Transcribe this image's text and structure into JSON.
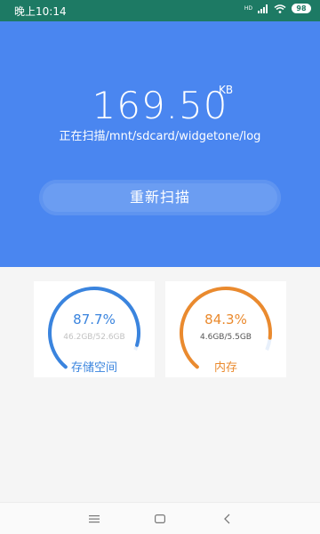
{
  "status_bar": {
    "time": "晚上10:14",
    "signal_label": "HD",
    "battery": "98"
  },
  "scan": {
    "size_value": "169.50",
    "size_unit": "KB",
    "path_text": "正在扫描/mnt/sdcard/widgetone/log",
    "rescan_label": "重新扫描"
  },
  "storage": {
    "percent_text": "87.7%",
    "percent": 0.877,
    "detail": "46.2GB/52.6GB",
    "label": "存储空间",
    "color": "#3a84de"
  },
  "memory": {
    "percent_text": "84.3%",
    "percent": 0.843,
    "detail": "4.6GB/5.5GB",
    "label": "内存",
    "color": "#ea8a2e"
  },
  "nav": {
    "menu_icon": "menu-icon",
    "home_icon": "home-icon",
    "back_icon": "back-icon"
  },
  "colors": {
    "primary": "#4a86f0",
    "status_bar": "#1d7a64",
    "track": "#e8f0fb"
  }
}
